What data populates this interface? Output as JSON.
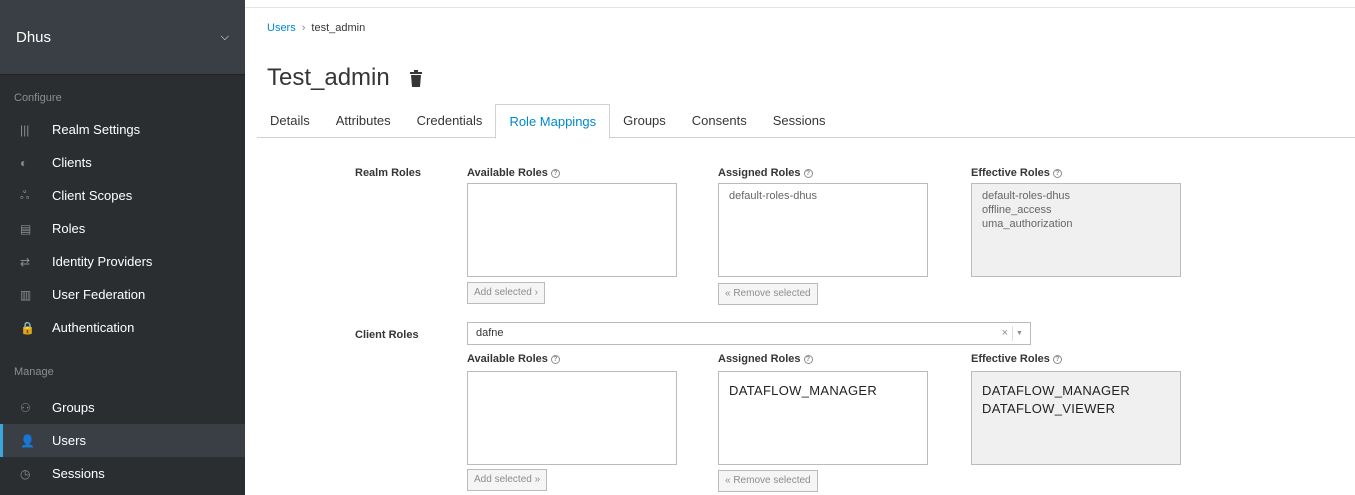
{
  "sidebar": {
    "realm": "Dhus",
    "configure_label": "Configure",
    "configure_items": [
      {
        "label": "Realm Settings",
        "icon": "realm-settings-icon",
        "glyph": "|||"
      },
      {
        "label": "Clients",
        "icon": "clients-icon",
        "glyph": "◐"
      },
      {
        "label": "Client Scopes",
        "icon": "client-scopes-icon",
        "glyph": "ஃ"
      },
      {
        "label": "Roles",
        "icon": "roles-icon",
        "glyph": "▤"
      },
      {
        "label": "Identity Providers",
        "icon": "identity-providers-icon",
        "glyph": "⇄"
      },
      {
        "label": "User Federation",
        "icon": "user-federation-icon",
        "glyph": "▥"
      },
      {
        "label": "Authentication",
        "icon": "lock-icon",
        "glyph": "🔒"
      }
    ],
    "manage_label": "Manage",
    "manage_items": [
      {
        "label": "Groups",
        "icon": "groups-icon",
        "glyph": "⚇"
      },
      {
        "label": "Users",
        "icon": "user-icon",
        "glyph": "👤"
      },
      {
        "label": "Sessions",
        "icon": "clock-icon",
        "glyph": "◷"
      }
    ]
  },
  "breadcrumb": {
    "parent": "Users",
    "current": "test_admin"
  },
  "title": "Test_admin",
  "tabs": [
    "Details",
    "Attributes",
    "Credentials",
    "Role Mappings",
    "Groups",
    "Consents",
    "Sessions"
  ],
  "active_tab": "Role Mappings",
  "realm_roles": {
    "label": "Realm Roles",
    "available_label": "Available Roles",
    "assigned_label": "Assigned Roles",
    "effective_label": "Effective Roles",
    "available": [],
    "assigned": [
      "default-roles-dhus"
    ],
    "effective": [
      "default-roles-dhus",
      "offline_access",
      "uma_authorization"
    ],
    "add_btn": "Add selected ›",
    "remove_btn": "« Remove selected"
  },
  "client_roles": {
    "label": "Client Roles",
    "client": "dafne",
    "clear": "×",
    "available_label": "Available Roles",
    "assigned_label": "Assigned Roles",
    "effective_label": "Effective Roles",
    "available": [],
    "assigned": [
      "DATAFLOW_MANAGER"
    ],
    "effective": [
      "DATAFLOW_MANAGER",
      "DATAFLOW_VIEWER"
    ],
    "add_btn": "Add selected »",
    "remove_btn": "« Remove selected"
  },
  "colors": {
    "accent": "#0088ce",
    "sidebar": "#2b2e31",
    "active_bar": "#39a5dc"
  }
}
